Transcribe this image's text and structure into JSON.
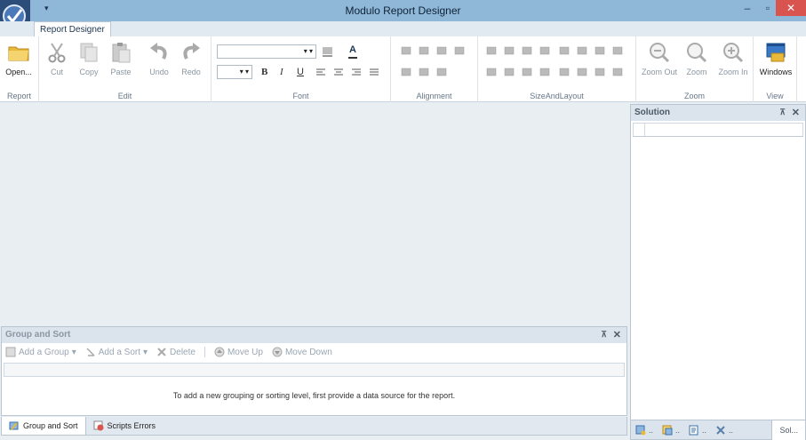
{
  "window": {
    "title": "Modulo Report Designer",
    "qat_glyph": "▾",
    "min_glyph": "–",
    "max_glyph": "▫",
    "close_glyph": "✕"
  },
  "tabs": {
    "active": "Report Designer"
  },
  "ribbon": {
    "report": {
      "label": "Report",
      "open": "Open..."
    },
    "edit": {
      "label": "Edit",
      "cut": "Cut",
      "copy": "Copy",
      "paste": "Paste",
      "undo": "Undo",
      "redo": "Redo"
    },
    "font": {
      "label": "Font",
      "family_value": "",
      "size_value": "",
      "bold": "B",
      "italic": "I",
      "underline": "U",
      "font_color_glyph": "A"
    },
    "alignment": {
      "label": "Alignment"
    },
    "size_layout": {
      "label": "SizeAndLayout"
    },
    "zoom": {
      "label": "Zoom",
      "zoom_out": "Zoom Out",
      "zoom": "Zoom",
      "zoom_in": "Zoom In"
    },
    "view": {
      "label": "View",
      "windows": "Windows"
    }
  },
  "solution": {
    "title": "Solution",
    "pin_glyph": "⊼",
    "close_glyph": "✕",
    "tabs": [
      "..",
      "..",
      "..",
      "..",
      "Sol..."
    ]
  },
  "group_sort": {
    "title": "Group and Sort",
    "pin_glyph": "⊼",
    "close_glyph": "✕",
    "add_group": "Add a Group",
    "add_sort": "Add a Sort",
    "delete": "Delete",
    "move_up": "Move Up",
    "move_down": "Move Down",
    "message": "To add a new grouping or sorting level, first provide a data source for the report."
  },
  "bottom_tabs": {
    "group_sort": "Group and Sort",
    "scripts_errors": "Scripts Errors"
  },
  "colors": {
    "titlebar": "#8fb8d8",
    "close": "#d9534f",
    "accent": "#1b3550"
  }
}
